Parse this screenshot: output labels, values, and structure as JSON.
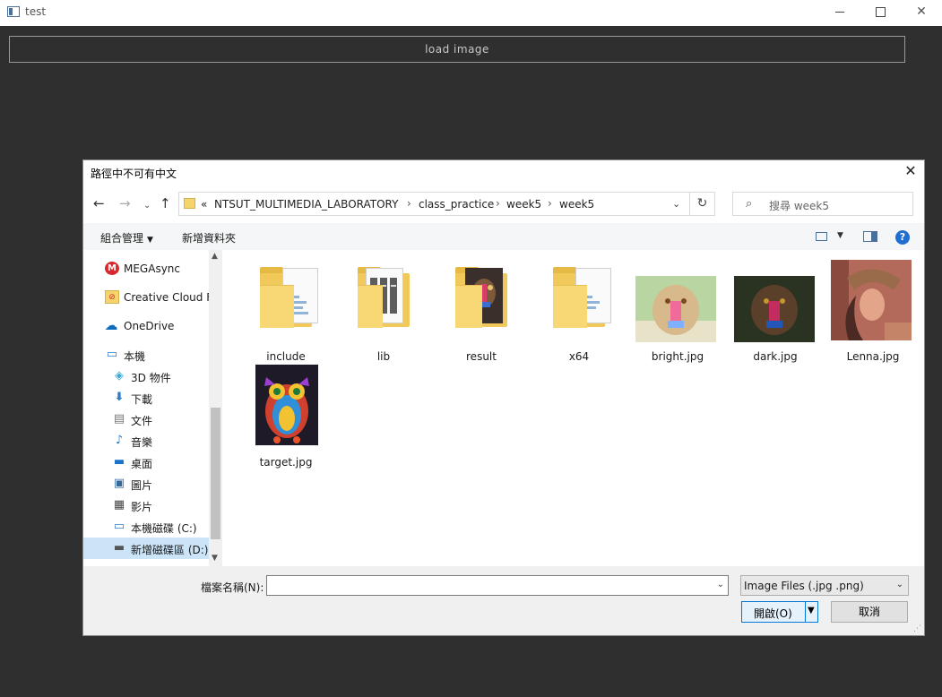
{
  "app": {
    "title": "test",
    "load_button": "load image"
  },
  "dialog": {
    "title": "路徑中不可有中文",
    "address": {
      "prefix": "«",
      "crumbs": [
        "NTSUT_MULTIMEDIA_LABORATORY",
        "class_practice",
        "week5",
        "week5"
      ],
      "separator": "›"
    },
    "search_placeholder": "搜尋 week5",
    "toolbar": {
      "organize": "組合管理",
      "new_folder": "新增資料夾"
    },
    "nav": [
      {
        "label": "MEGAsync",
        "icon": "megasync-icon"
      },
      {
        "label": "Creative Cloud Fi",
        "icon": "creative-cloud-icon"
      },
      {
        "label": "OneDrive",
        "icon": "onedrive-icon"
      },
      {
        "label": "本機",
        "icon": "computer-icon"
      },
      {
        "label": "3D 物件",
        "icon": "3d-objects-icon"
      },
      {
        "label": "下載",
        "icon": "download-icon"
      },
      {
        "label": "文件",
        "icon": "documents-icon"
      },
      {
        "label": "音樂",
        "icon": "music-icon"
      },
      {
        "label": "桌面",
        "icon": "desktop-icon"
      },
      {
        "label": "圖片",
        "icon": "pictures-icon"
      },
      {
        "label": "影片",
        "icon": "videos-icon"
      },
      {
        "label": "本機磁碟 (C:)",
        "icon": "drive-c-icon"
      },
      {
        "label": "新增磁碟區 (D:)",
        "icon": "drive-d-icon"
      }
    ],
    "files": [
      {
        "name": "include",
        "type": "folder"
      },
      {
        "name": "lib",
        "type": "folder"
      },
      {
        "name": "result",
        "type": "folder"
      },
      {
        "name": "x64",
        "type": "folder"
      },
      {
        "name": "bright.jpg",
        "type": "image"
      },
      {
        "name": "dark.jpg",
        "type": "image"
      },
      {
        "name": "Lenna.jpg",
        "type": "image"
      },
      {
        "name": "target.jpg",
        "type": "image"
      }
    ],
    "filename_label": "檔案名稱(N):",
    "filename_value": "",
    "filter": "Image Files (.jpg .png)",
    "open_button": "開啟(O)",
    "cancel_button": "取消"
  }
}
